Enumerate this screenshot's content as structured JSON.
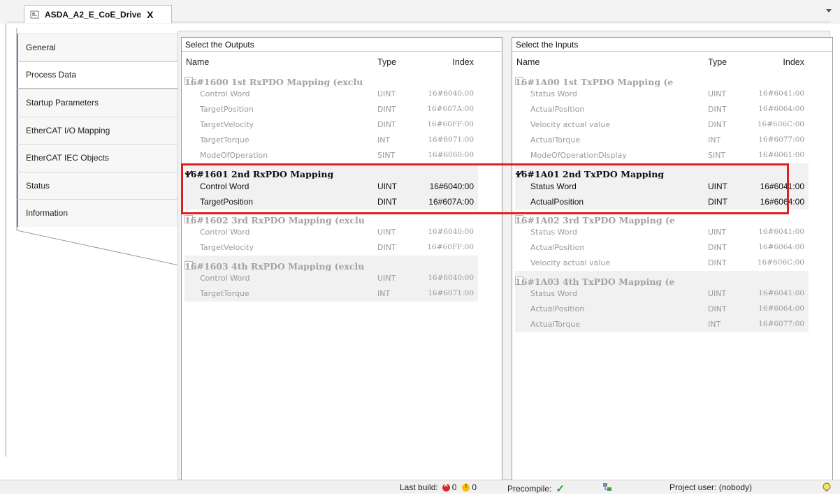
{
  "document_tab": {
    "title": "ASDA_A2_E_CoE_Drive",
    "close": "X"
  },
  "sidebar": {
    "items": [
      {
        "label": "General"
      },
      {
        "label": "Process Data",
        "active": true
      },
      {
        "label": "Startup Parameters"
      },
      {
        "label": "EtherCAT I/O Mapping"
      },
      {
        "label": "EtherCAT IEC Objects"
      },
      {
        "label": "Status"
      },
      {
        "label": "Information"
      }
    ]
  },
  "outputs": {
    "title": "Select the Outputs",
    "columns": {
      "name": "Name",
      "type": "Type",
      "index": "Index"
    },
    "groups": [
      {
        "name": "16#1600 1st RxPDO Mapping (exclu",
        "checked": false,
        "entries": [
          {
            "name": "Control Word",
            "type": "UINT",
            "index": "16#6040:00"
          },
          {
            "name": "TargetPosition",
            "type": "DINT",
            "index": "16#607A:00"
          },
          {
            "name": "TargetVelocity",
            "type": "DINT",
            "index": "16#60FF:00"
          },
          {
            "name": "TargetTorque",
            "type": "INT",
            "index": "16#6071:00"
          },
          {
            "name": "ModeOfOperation",
            "type": "SINT",
            "index": "16#6060:00"
          }
        ]
      },
      {
        "name": "16#1601 2nd RxPDO Mapping",
        "checked": true,
        "entries": [
          {
            "name": "Control Word",
            "type": "UINT",
            "index": "16#6040:00"
          },
          {
            "name": "TargetPosition",
            "type": "DINT",
            "index": "16#607A:00"
          }
        ]
      },
      {
        "name": "16#1602 3rd RxPDO Mapping (exclu",
        "checked": false,
        "entries": [
          {
            "name": "Control Word",
            "type": "UINT",
            "index": "16#6040:00"
          },
          {
            "name": "TargetVelocity",
            "type": "DINT",
            "index": "16#60FF:00"
          }
        ]
      },
      {
        "name": "16#1603 4th RxPDO Mapping (exclu",
        "checked": false,
        "entries": [
          {
            "name": "Control Word",
            "type": "UINT",
            "index": "16#6040:00"
          },
          {
            "name": "TargetTorque",
            "type": "INT",
            "index": "16#6071:00"
          }
        ]
      }
    ]
  },
  "inputs": {
    "title": "Select the Inputs",
    "columns": {
      "name": "Name",
      "type": "Type",
      "index": "Index"
    },
    "groups": [
      {
        "name": "16#1A00 1st TxPDO Mapping (e",
        "checked": false,
        "entries": [
          {
            "name": "Status Word",
            "type": "UINT",
            "index": "16#6041:00"
          },
          {
            "name": "ActualPosition",
            "type": "DINT",
            "index": "16#6064:00"
          },
          {
            "name": "Velocity actual value",
            "type": "DINT",
            "index": "16#606C:00"
          },
          {
            "name": "ActualTorque",
            "type": "INT",
            "index": "16#6077:00"
          },
          {
            "name": "ModeOfOperationDisplay",
            "type": "SINT",
            "index": "16#6061:00"
          }
        ]
      },
      {
        "name": "16#1A01 2nd TxPDO Mapping",
        "checked": true,
        "entries": [
          {
            "name": "Status Word",
            "type": "UINT",
            "index": "16#6041:00"
          },
          {
            "name": "ActualPosition",
            "type": "DINT",
            "index": "16#6064:00"
          }
        ]
      },
      {
        "name": "16#1A02 3rd TxPDO Mapping (e",
        "checked": false,
        "entries": [
          {
            "name": "Status Word",
            "type": "UINT",
            "index": "16#6041:00"
          },
          {
            "name": "ActualPosition",
            "type": "DINT",
            "index": "16#6064:00"
          },
          {
            "name": "Velocity actual value",
            "type": "DINT",
            "index": "16#606C:00"
          }
        ]
      },
      {
        "name": "16#1A03 4th TxPDO Mapping (e",
        "checked": false,
        "entries": [
          {
            "name": "Status Word",
            "type": "UINT",
            "index": "16#6041:00"
          },
          {
            "name": "ActualPosition",
            "type": "DINT",
            "index": "16#6064:00"
          },
          {
            "name": "ActualTorque",
            "type": "INT",
            "index": "16#6077:00"
          }
        ]
      }
    ]
  },
  "statusbar": {
    "last_build_label": "Last build:",
    "errors": "0",
    "warnings": "0",
    "precompile_label": "Precompile:",
    "project_user": "Project user: (nobody)"
  },
  "colors": {
    "highlight": "#e01f1f",
    "tab_accent": "#4a8ec9",
    "check_green": "#2e9d2e"
  }
}
